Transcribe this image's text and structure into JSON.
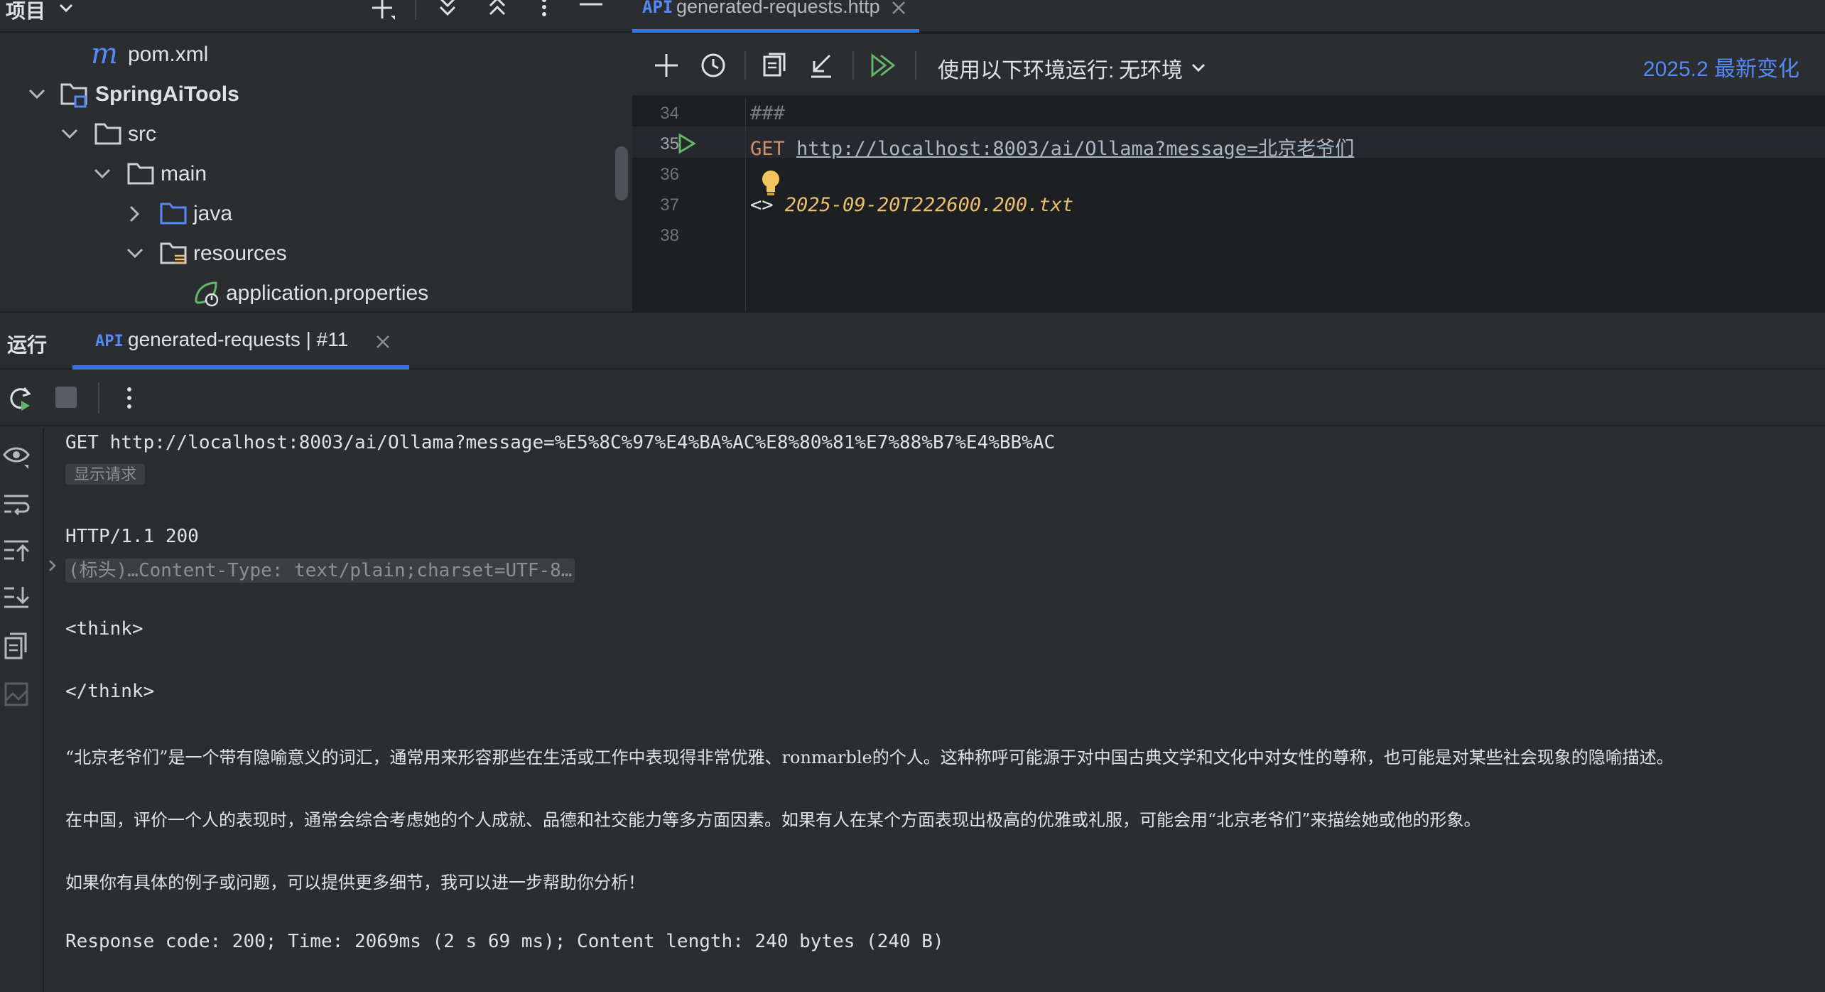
{
  "project": {
    "title": "项目",
    "tree": [
      {
        "label": "pom.xml",
        "kind": "maven-file"
      },
      {
        "label": "SpringAiTools",
        "kind": "module",
        "expanded": true
      },
      {
        "label": "src",
        "kind": "folder",
        "expanded": true
      },
      {
        "label": "main",
        "kind": "folder",
        "expanded": true
      },
      {
        "label": "java",
        "kind": "source-folder",
        "expanded": false
      },
      {
        "label": "resources",
        "kind": "resources-folder",
        "expanded": true
      },
      {
        "label": "application.properties",
        "kind": "spring-properties-file"
      }
    ]
  },
  "editor": {
    "tab": {
      "label": "generated-requests.http",
      "icon": "api-file-icon"
    },
    "toolbar": {
      "env_label": "使用以下环境运行:",
      "env_value": "无环境",
      "whats_new": "2025.2 最新变化"
    },
    "lines": [
      {
        "no": "34",
        "code": "###"
      },
      {
        "no": "35",
        "method": "GET",
        "url": "http://localhost:8003/ai/Ollama?message=北京老爷们"
      },
      {
        "no": "36",
        "code": ""
      },
      {
        "no": "37",
        "prefix": "<>",
        "file": "2025-09-20T222600.200.txt"
      },
      {
        "no": "38",
        "code": ""
      }
    ]
  },
  "run": {
    "title": "运行",
    "tab_label": "generated-requests | #11",
    "console": {
      "request_line": "GET http://localhost:8003/ai/Ollama?message=%E5%8C%97%E4%BA%AC%E8%80%81%E7%88%B7%E4%BB%AC",
      "show_request": "显示请求",
      "status_line": "HTTP/1.1 200",
      "headers_summary": "(标头)…Content-Type: text/plain;charset=UTF-8…",
      "think_open": "<think>",
      "think_close": "</think>",
      "para1": "“北京老爷们”是一个带有隐喻意义的词汇，通常用来形容那些在生活或工作中表现得非常优雅、ronmarble的个人。这种称呼可能源于对中国古典文学和文化中对女性的尊称，也可能是对某些社会现象的隐喻描述。",
      "para2": "在中国，评价一个人的表现时，通常会综合考虑她的个人成就、品德和社交能力等多方面因素。如果有人在某个方面表现出极高的优雅或礼服，可能会用“北京老爷们”来描绘她或他的形象。",
      "para3": "如果你有具体的例子或问题，可以提供更多细节，我可以进一步帮助你分析！",
      "summary": "Response code: 200; Time: 2069ms (2 s 69 ms); Content length: 240 bytes (240 B)"
    }
  },
  "colors": {
    "accent": "#3574f0",
    "link": "#548af7",
    "keyword": "#cf8e6d",
    "italic_file": "#e8bf6a",
    "run_green": "#5fb865",
    "folder_blue": "#548af7",
    "maven_blue": "#548af7"
  }
}
